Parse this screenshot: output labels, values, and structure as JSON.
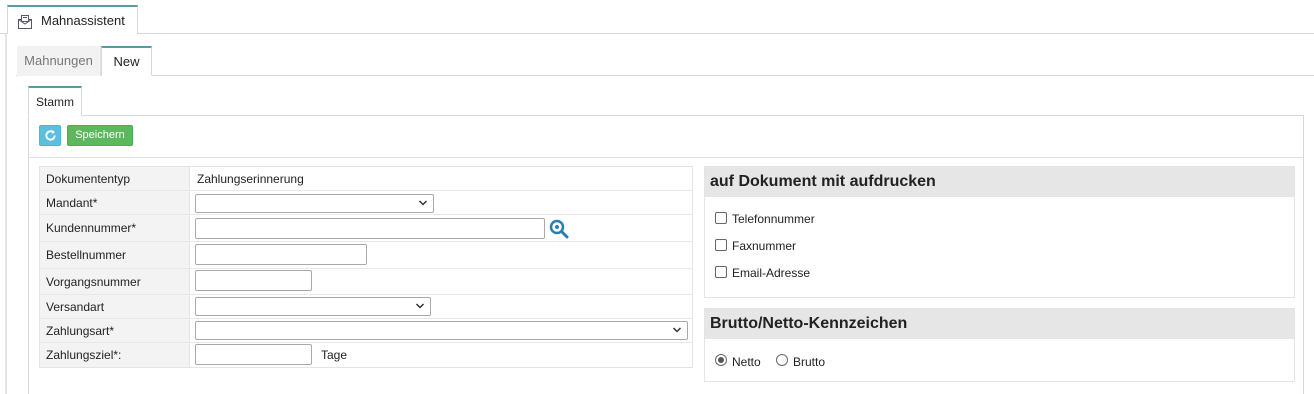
{
  "app": {
    "tab_title": "Mahnassistent"
  },
  "tabs": [
    {
      "label": "Mahnungen",
      "active": false
    },
    {
      "label": "New",
      "active": true
    }
  ],
  "subtab": {
    "label": "Stamm"
  },
  "toolbar": {
    "refresh_icon": "refresh-icon",
    "save_label": "Speichern"
  },
  "form": {
    "rows": [
      {
        "label": "Dokumententyp",
        "value": "Zahlungserinnerung"
      },
      {
        "label": "Mandant*",
        "value": ""
      },
      {
        "label": "Kundennummer*",
        "value": ""
      },
      {
        "label": "Bestellnummer",
        "value": ""
      },
      {
        "label": "Vorgangsnummer",
        "value": ""
      },
      {
        "label": "Versandart",
        "value": ""
      },
      {
        "label": "Zahlungsart*",
        "value": ""
      },
      {
        "label": "Zahlungsziel*:",
        "value": "",
        "suffix": "Tage"
      }
    ]
  },
  "print_section": {
    "title": "auf Dokument mit aufdrucken",
    "options": [
      {
        "label": "Telefonnummer",
        "checked": false
      },
      {
        "label": "Faxnummer",
        "checked": false
      },
      {
        "label": "Email-Adresse",
        "checked": false
      }
    ]
  },
  "brutto_section": {
    "title": "Brutto/Netto-Kennzeichen",
    "options": [
      {
        "label": "Netto",
        "selected": true
      },
      {
        "label": "Brutto",
        "selected": false
      }
    ]
  },
  "colors": {
    "accent": "#5a9aa6",
    "save": "#5cb85c",
    "refresh": "#5bc0de",
    "search_icon": "#2a7fb0"
  }
}
